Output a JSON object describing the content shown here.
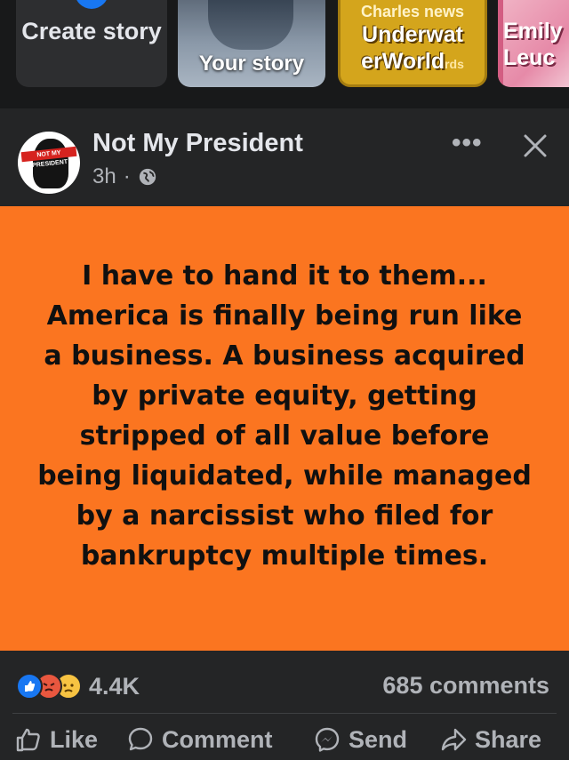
{
  "stories": {
    "create_label": "Create story",
    "your_story_label": "Your story",
    "news_channel": "Charles news",
    "news_title_1": "Underwat",
    "news_title_2": "erWorld",
    "news_title_suffix": "rds",
    "emily_label": "Emily Leuc"
  },
  "post": {
    "author": "Not My President",
    "avatar_banner": "NOT MY PRESIDENT",
    "time": "3h",
    "dot": "·",
    "text": "I have to hand it to them... America is finally being run like a business. A business acquired by private equity, getting stripped of all value before being liquidated, while managed by a narcissist who filed for bankruptcy multiple times.",
    "background_color": "#fb7520",
    "reaction_count": "4.4K",
    "comments_count": "685 comments"
  },
  "actions": {
    "like": "Like",
    "comment": "Comment",
    "send": "Send",
    "share": "Share"
  }
}
